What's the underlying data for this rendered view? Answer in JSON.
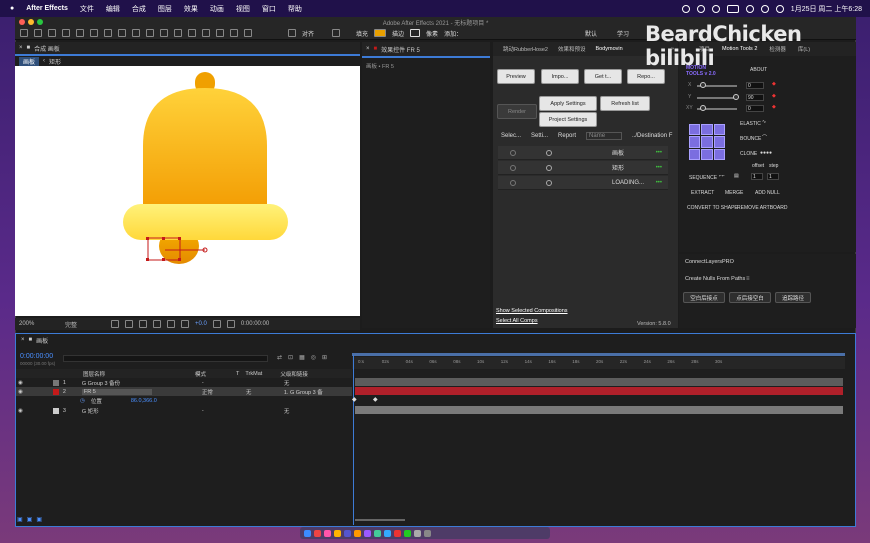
{
  "menubar": {
    "app": "After Effects",
    "items": [
      "文件",
      "编辑",
      "合成",
      "图层",
      "效果",
      "动画",
      "视图",
      "窗口",
      "帮助"
    ],
    "clock": "1月25日 周二 上午6:28"
  },
  "window": {
    "title": "Adobe After Effects 2021 - 无标题项目 *"
  },
  "toolbar": {
    "align_label": "对齐",
    "fill_label": "填充",
    "stroke_label": "描边",
    "px_label": "像素",
    "add_label": "添加：",
    "workspaces": [
      "默认",
      "学习"
    ]
  },
  "comp_panel": {
    "tab": "合成 画板",
    "breadcrumb": [
      "画板",
      "矩形"
    ]
  },
  "effect_panel": {
    "tab": "效果控件 FR 5",
    "sub": "画板 • FR 5"
  },
  "viewer_controls": {
    "zoom": "200%",
    "quality": "完整",
    "exposure": "+0.0",
    "timecode": "0:00:00:00"
  },
  "bodymovin": {
    "tabs": [
      "跳动RubberHose2",
      "效果和预设",
      "Bodymovin"
    ],
    "buttons": [
      "Preview",
      "Impo...",
      "Get t...",
      "Repo...",
      "Render",
      "Apply Settings",
      "Refresh list",
      "Project Settings"
    ],
    "headers": [
      "Selec...",
      "Setti...",
      "Report",
      "Name",
      "../Destination F"
    ],
    "rows": [
      {
        "name": "画板",
        "menu": "•••"
      },
      {
        "name": "矩形",
        "menu": "•••"
      },
      {
        "name": "LOADING...",
        "menu": "•••"
      }
    ],
    "links": [
      "Show Selected Compositions",
      "Select All Comps"
    ],
    "version": "Version: 5.8.0"
  },
  "motion_tools": {
    "tabs": [
      "项目",
      "Motion Tools 2",
      "检测器",
      "库(L)"
    ],
    "logo": "MOTION TOOLS v 2.0",
    "about": "ABOUT",
    "sliders": [
      {
        "label": "X",
        "value": "0"
      },
      {
        "label": "Y",
        "value": "90"
      },
      {
        "label": "XY",
        "value": "0"
      }
    ],
    "elastic": "ELASTIC",
    "bounce": "BOUNCE",
    "clone": "CLONE",
    "offset": "offset",
    "step": "step",
    "sequence": "SEQUENCE",
    "seq_vals": [
      "1",
      "1"
    ],
    "actions": [
      "EXTRACT",
      "MERGE",
      "ADD NULL",
      "CONVERT TO SHAPE",
      "REMOVE ARTBOARD"
    ]
  },
  "connect_layers": {
    "tab": "ConnectLayersPRO",
    "nulls_tab": "Create Nulls From Paths",
    "buttons": [
      "空白后接点",
      "点后接空白",
      "追踪路径"
    ]
  },
  "timeline": {
    "tab": "画板",
    "timecode": "0:00:00:00",
    "fps": "00000 (30.00 fps)",
    "columns": [
      "图层名称",
      "模式",
      "T",
      "TrkMat",
      "父级和链接"
    ],
    "layers": [
      {
        "num": "1",
        "name": "G Group 3 备份",
        "mode": "-",
        "trk": "",
        "parent": "无",
        "color": "#777777"
      },
      {
        "num": "2",
        "name": "FR 5",
        "mode": "正常",
        "trk": "无",
        "parent": "1. G Group 3 备",
        "color": "#c41a1a"
      },
      {
        "num": "",
        "name": "位置",
        "mode": "",
        "trk": "",
        "parent": "",
        "value": "86.0,366.0",
        "color": ""
      },
      {
        "num": "3",
        "name": "G 矩形",
        "mode": "-",
        "trk": "",
        "parent": "无",
        "color": "#cccccc"
      }
    ],
    "ruler": [
      "0:s",
      "02s",
      "04s",
      "06s",
      "08s",
      "10s",
      "12s",
      "14s",
      "16s",
      "18s",
      "20s",
      "22s",
      "24s",
      "26s",
      "28s",
      "30s"
    ]
  },
  "watermark": "BeardChicken bilibili"
}
